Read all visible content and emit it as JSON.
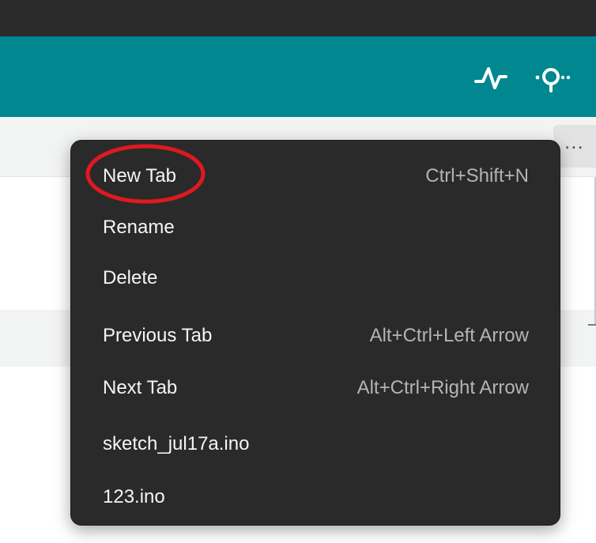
{
  "toolbar": {
    "icons": [
      "serial-plotter-icon",
      "serial-monitor-icon"
    ],
    "color": "#00878f"
  },
  "tab_strip": {
    "menu_button_label": "..."
  },
  "context_menu": {
    "items": [
      {
        "label": "New Tab",
        "shortcut": "Ctrl+Shift+N"
      },
      {
        "label": "Rename",
        "shortcut": ""
      },
      {
        "label": "Delete",
        "shortcut": ""
      },
      {
        "label": "Previous Tab",
        "shortcut": "Alt+Ctrl+Left Arrow"
      },
      {
        "label": "Next Tab",
        "shortcut": "Alt+Ctrl+Right Arrow"
      },
      {
        "label": "sketch_jul17a.ino",
        "shortcut": ""
      },
      {
        "label": "123.ino",
        "shortcut": ""
      }
    ]
  },
  "annotation": {
    "highlight_color": "#e0191f",
    "highlighted_item": "New Tab"
  }
}
